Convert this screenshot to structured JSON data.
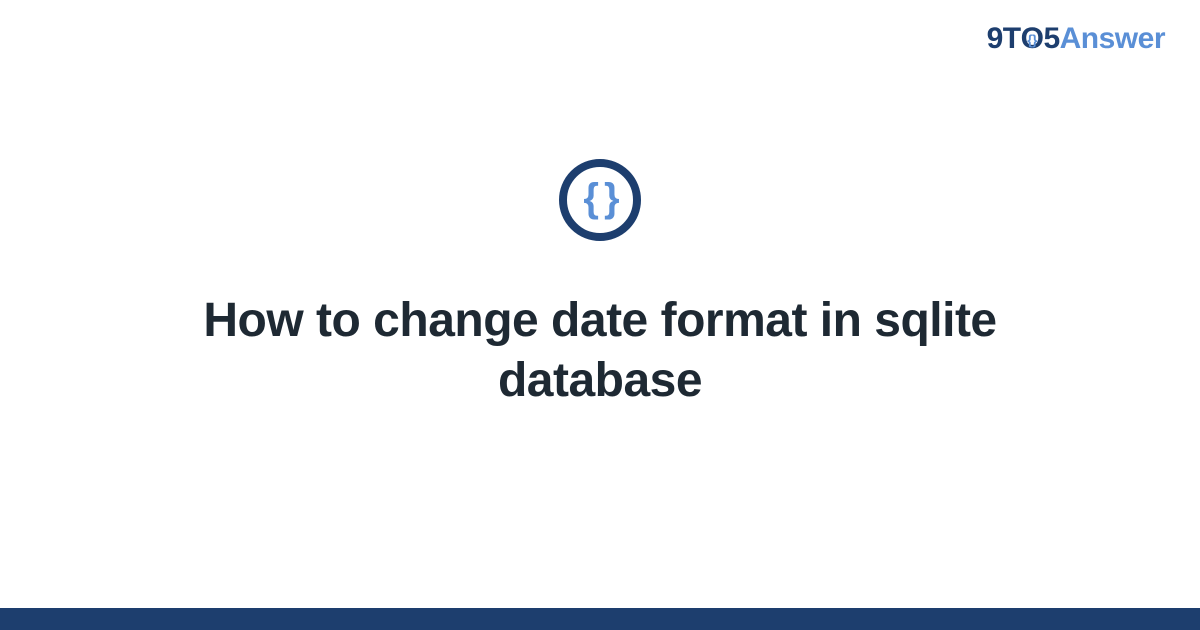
{
  "logo": {
    "part1": "9T",
    "o_outer": "O",
    "o_inner": "{}",
    "part2": "5",
    "part3": "Answer"
  },
  "icon": {
    "braces": "{ }"
  },
  "title": "How to change date format in sqlite database"
}
